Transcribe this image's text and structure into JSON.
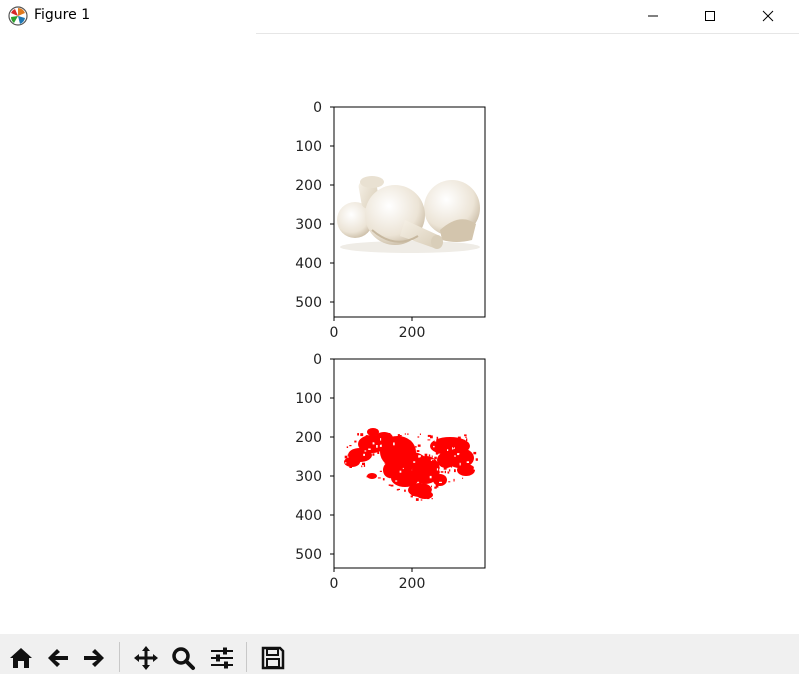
{
  "window": {
    "title": "Figure 1",
    "minimize_icon": "minimize-icon",
    "maximize_icon": "maximize-icon",
    "close_icon": "close-icon"
  },
  "figure": {
    "top_image": {
      "description_icon": "mushroom-photo",
      "xticks": [
        "0",
        "200"
      ],
      "yticks": [
        "0",
        "100",
        "200",
        "300",
        "400",
        "500"
      ]
    },
    "bottom_image": {
      "mask_color": "#ff0000",
      "xticks": [
        "0",
        "200"
      ],
      "yticks": [
        "0",
        "100",
        "200",
        "300",
        "400",
        "500"
      ]
    }
  },
  "toolbar": {
    "buttons": [
      {
        "icon": "home-icon"
      },
      {
        "icon": "back-arrow-icon"
      },
      {
        "icon": "forward-arrow-icon"
      },
      {
        "icon": "pan-icon"
      },
      {
        "icon": "zoom-icon"
      },
      {
        "icon": "configure-subplots-icon"
      },
      {
        "icon": "save-icon"
      }
    ]
  }
}
